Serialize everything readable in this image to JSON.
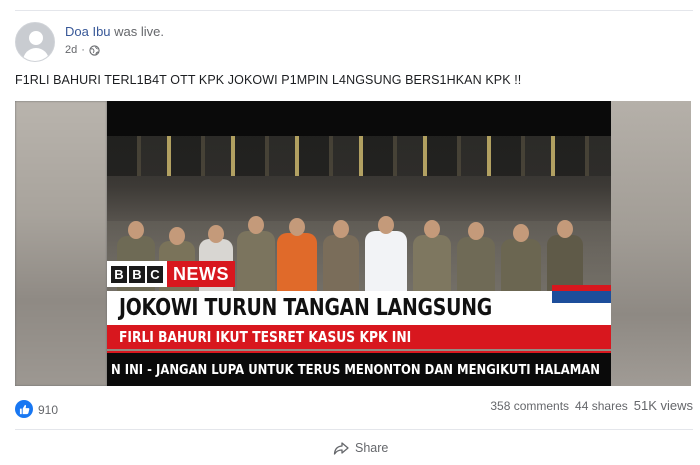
{
  "post": {
    "author_name": "Doa Ibu",
    "author_action": " was live.",
    "timestamp": "2d",
    "separator": "·",
    "privacy_icon": "globe-icon",
    "text": "F1RLI BAHURI TERL1B4T OTT KPK JOKOWI P1MPIN L4NGSUNG BERS1HKAN KPK !!"
  },
  "video": {
    "bbc_letters": [
      "B",
      "B",
      "C"
    ],
    "news_label": "NEWS",
    "headline": "JOKOWI TURUN TANGAN LANGSUNG",
    "subheadline": "FIRLI BAHURI IKUT TESRET KASUS KPK INI",
    "ticker": "N INI - JANGAN LUPA UNTUK TERUS MENONTON DAN MENGIKUTI HALAMAN"
  },
  "stats": {
    "reaction_icon": "thumbs-up-icon",
    "reactions": "910",
    "comments": "358 comments",
    "shares": "44 shares",
    "views": "51K views"
  },
  "actions": {
    "share_icon": "share-arrow-icon",
    "share_label": "Share"
  },
  "colors": {
    "link_blue": "#385898",
    "like_blue": "#1877f2",
    "bbc_red": "#d8171e",
    "secondary_text": "#65676b"
  }
}
